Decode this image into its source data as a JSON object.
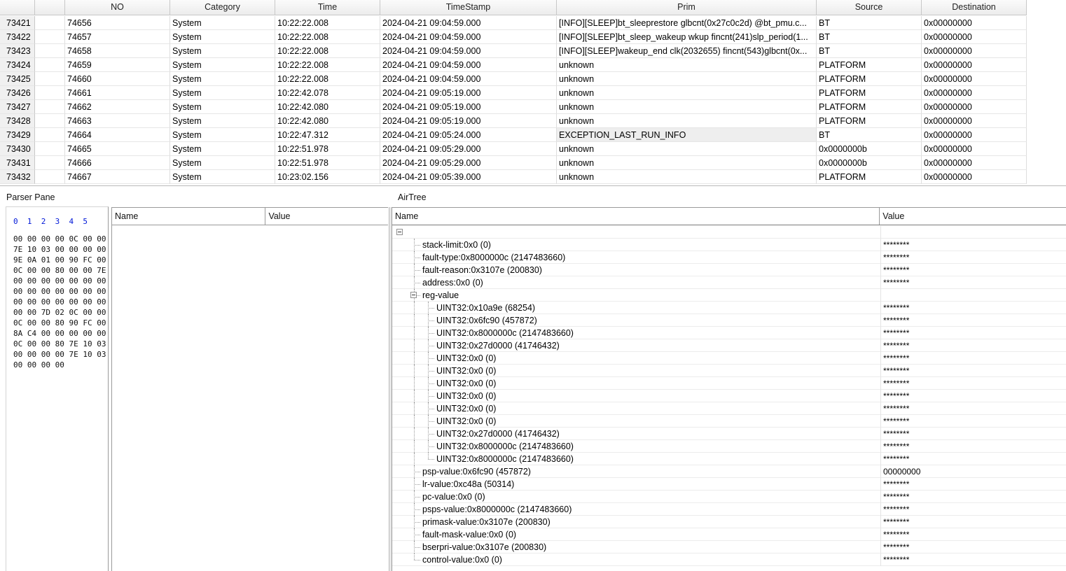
{
  "log_table": {
    "columns": [
      "",
      "",
      "NO",
      "Category",
      "Time",
      "TimeStamp",
      "Prim",
      "Source",
      "Destination"
    ],
    "rows": [
      {
        "idx": "73421",
        "no": "74656",
        "category": "System",
        "time": "10:22:22.008",
        "timestamp": "2024-04-21 09:04:59.000",
        "prim": "[INFO][SLEEP]bt_sleeprestore glbcnt(0x27c0c2d) @bt_pmu.c...",
        "source": "BT",
        "dest": "0x00000000"
      },
      {
        "idx": "73422",
        "no": "74657",
        "category": "System",
        "time": "10:22:22.008",
        "timestamp": "2024-04-21 09:04:59.000",
        "prim": "[INFO][SLEEP]bt_sleep_wakeup wkup fincnt(241)slp_period(1...",
        "source": "BT",
        "dest": "0x00000000"
      },
      {
        "idx": "73423",
        "no": "74658",
        "category": "System",
        "time": "10:22:22.008",
        "timestamp": "2024-04-21 09:04:59.000",
        "prim": "[INFO][SLEEP]wakeup_end clk(2032655) fincnt(543)glbcnt(0x...",
        "source": "BT",
        "dest": "0x00000000"
      },
      {
        "idx": "73424",
        "no": "74659",
        "category": "System",
        "time": "10:22:22.008",
        "timestamp": "2024-04-21 09:04:59.000",
        "prim": "unknown",
        "source": "PLATFORM",
        "dest": "0x00000000"
      },
      {
        "idx": "73425",
        "no": "74660",
        "category": "System",
        "time": "10:22:22.008",
        "timestamp": "2024-04-21 09:04:59.000",
        "prim": "unknown",
        "source": "PLATFORM",
        "dest": "0x00000000"
      },
      {
        "idx": "73426",
        "no": "74661",
        "category": "System",
        "time": "10:22:42.078",
        "timestamp": "2024-04-21 09:05:19.000",
        "prim": "unknown",
        "source": "PLATFORM",
        "dest": "0x00000000"
      },
      {
        "idx": "73427",
        "no": "74662",
        "category": "System",
        "time": "10:22:42.080",
        "timestamp": "2024-04-21 09:05:19.000",
        "prim": "unknown",
        "source": "PLATFORM",
        "dest": "0x00000000"
      },
      {
        "idx": "73428",
        "no": "74663",
        "category": "System",
        "time": "10:22:42.080",
        "timestamp": "2024-04-21 09:05:19.000",
        "prim": "unknown",
        "source": "PLATFORM",
        "dest": "0x00000000"
      },
      {
        "idx": "73429",
        "no": "74664",
        "category": "System",
        "time": "10:22:47.312",
        "timestamp": "2024-04-21 09:05:24.000",
        "prim": "EXCEPTION_LAST_RUN_INFO",
        "source": "BT",
        "dest": "0x00000000",
        "selected": true
      },
      {
        "idx": "73430",
        "no": "74665",
        "category": "System",
        "time": "10:22:51.978",
        "timestamp": "2024-04-21 09:05:29.000",
        "prim": "unknown",
        "source": "0x0000000b",
        "dest": "0x00000000"
      },
      {
        "idx": "73431",
        "no": "74666",
        "category": "System",
        "time": "10:22:51.978",
        "timestamp": "2024-04-21 09:05:29.000",
        "prim": "unknown",
        "source": "0x0000000b",
        "dest": "0x00000000"
      },
      {
        "idx": "73432",
        "no": "74667",
        "category": "System",
        "time": "10:23:02.156",
        "timestamp": "2024-04-21 09:05:39.000",
        "prim": "unknown",
        "source": "PLATFORM",
        "dest": "0x00000000"
      }
    ]
  },
  "parser_pane": {
    "title": "Parser Pane",
    "hex_index": "0  1  2  3  4  5",
    "hex_lines": [
      "00 00 00 00 0C 00 00",
      "7E 10 03 00 00 00 00",
      "9E 0A 01 00 90 FC 00",
      "0C 00 00 80 00 00 7E",
      "00 00 00 00 00 00 00",
      "00 00 00 00 00 00 00",
      "00 00 00 00 00 00 00",
      "00 00 7D 02 0C 00 00",
      "0C 00 00 80 90 FC 00",
      "8A C4 00 00 00 00 00",
      "0C 00 00 80 7E 10 03",
      "00 00 00 00 7E 10 03",
      "00 00 00 00"
    ],
    "grid_headers": {
      "name": "Name",
      "value": "Value"
    }
  },
  "airtree": {
    "title": "AirTree",
    "headers": {
      "name": "Name",
      "value": "Value"
    },
    "rows": [
      {
        "label": "",
        "value": "",
        "level": 0,
        "expander": true
      },
      {
        "label": "stack-limit:0x0 (0)",
        "value": "********",
        "level": 1
      },
      {
        "label": "fault-type:0x8000000c (2147483660)",
        "value": "********",
        "level": 1
      },
      {
        "label": "fault-reason:0x3107e (200830)",
        "value": "********",
        "level": 1
      },
      {
        "label": "address:0x0 (0)",
        "value": "********",
        "level": 1
      },
      {
        "label": "reg-value",
        "value": "",
        "level": 1,
        "expander": true
      },
      {
        "label": "UINT32:0x10a9e (68254)",
        "value": "********",
        "level": 2
      },
      {
        "label": "UINT32:0x6fc90 (457872)",
        "value": "********",
        "level": 2
      },
      {
        "label": "UINT32:0x8000000c (2147483660)",
        "value": "********",
        "level": 2
      },
      {
        "label": "UINT32:0x27d0000 (41746432)",
        "value": "********",
        "level": 2
      },
      {
        "label": "UINT32:0x0 (0)",
        "value": "********",
        "level": 2
      },
      {
        "label": "UINT32:0x0 (0)",
        "value": "********",
        "level": 2
      },
      {
        "label": "UINT32:0x0 (0)",
        "value": "********",
        "level": 2
      },
      {
        "label": "UINT32:0x0 (0)",
        "value": "********",
        "level": 2
      },
      {
        "label": "UINT32:0x0 (0)",
        "value": "********",
        "level": 2
      },
      {
        "label": "UINT32:0x0 (0)",
        "value": "********",
        "level": 2
      },
      {
        "label": "UINT32:0x27d0000 (41746432)",
        "value": "********",
        "level": 2
      },
      {
        "label": "UINT32:0x8000000c (2147483660)",
        "value": "********",
        "level": 2
      },
      {
        "label": "UINT32:0x8000000c (2147483660)",
        "value": "********",
        "level": 2
      },
      {
        "label": "psp-value:0x6fc90 (457872)",
        "value": "00000000",
        "level": 1
      },
      {
        "label": "lr-value:0xc48a (50314)",
        "value": "********",
        "level": 1
      },
      {
        "label": "pc-value:0x0 (0)",
        "value": "********",
        "level": 1
      },
      {
        "label": "psps-value:0x8000000c (2147483660)",
        "value": "********",
        "level": 1
      },
      {
        "label": "primask-value:0x3107e (200830)",
        "value": "********",
        "level": 1
      },
      {
        "label": "fault-mask-value:0x0 (0)",
        "value": "********",
        "level": 1
      },
      {
        "label": "bserpri-value:0x3107e (200830)",
        "value": "********",
        "level": 1
      },
      {
        "label": "control-value:0x0 (0)",
        "value": "********",
        "level": 1
      }
    ]
  }
}
